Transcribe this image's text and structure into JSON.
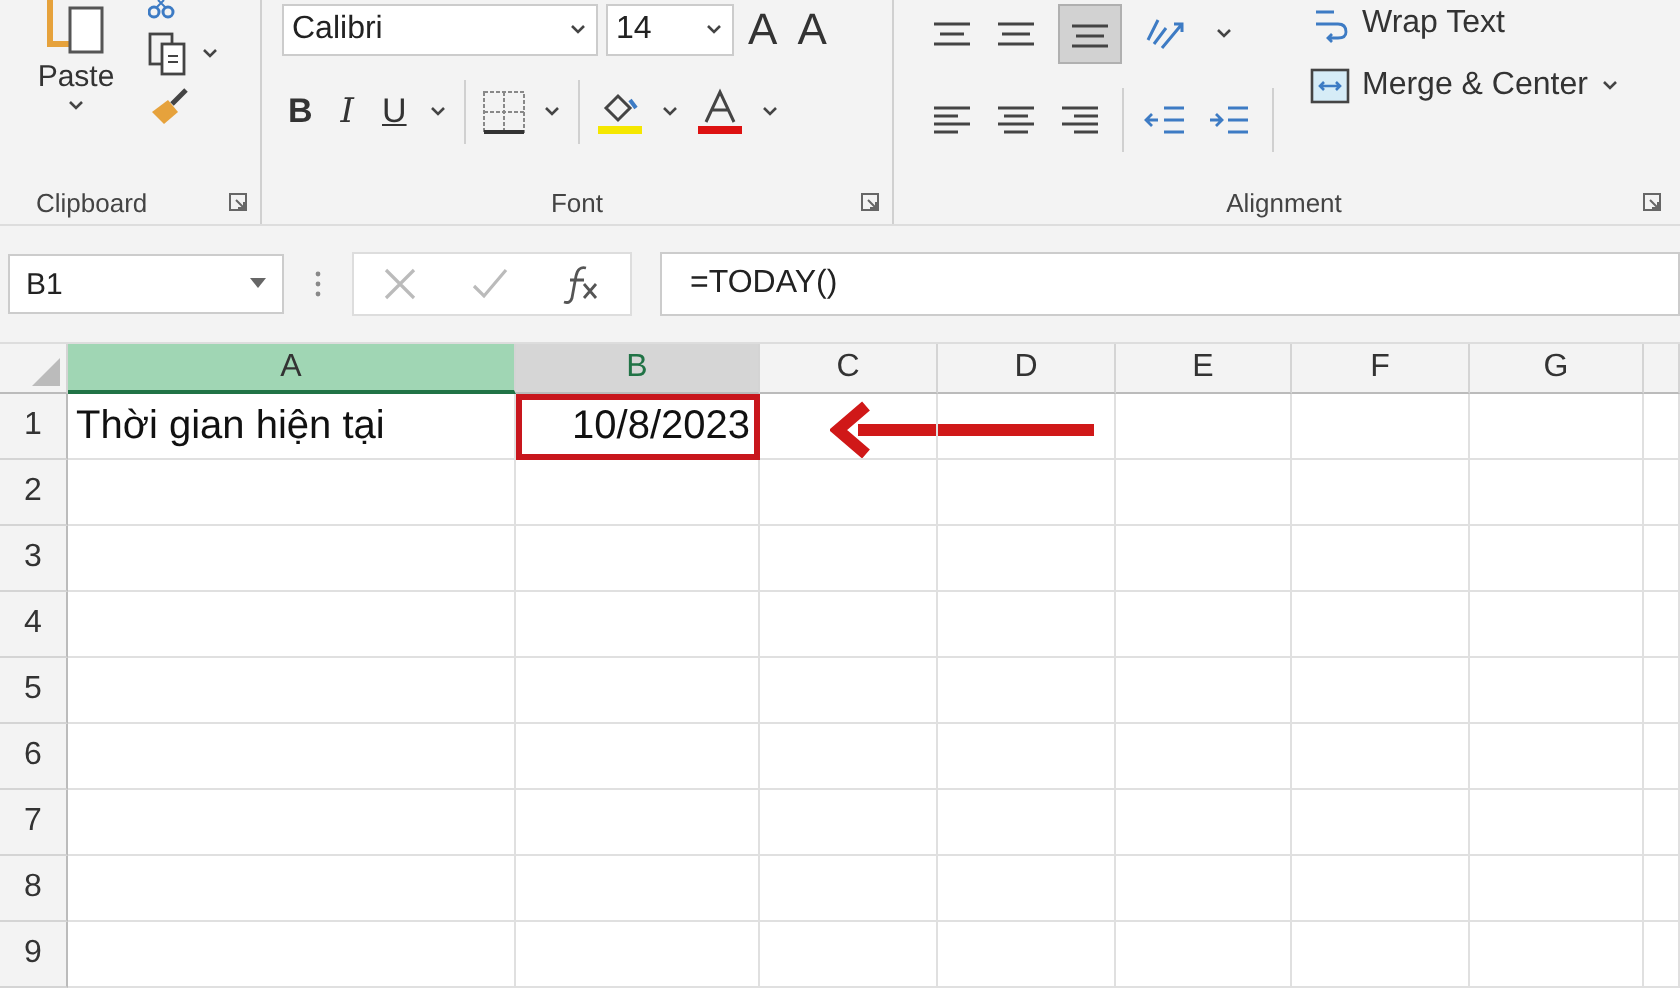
{
  "ribbon": {
    "clipboard": {
      "paste_label": "Paste",
      "group_label": "Clipboard"
    },
    "font": {
      "font_name": "Calibri",
      "font_size": "14",
      "bold": "B",
      "italic": "I",
      "underline": "U",
      "grow": "A",
      "shrink": "A",
      "group_label": "Font"
    },
    "alignment": {
      "wrap_text": "Wrap Text",
      "merge_center": "Merge & Center",
      "group_label": "Alignment",
      "middle_align_selected": true
    }
  },
  "formula_bar": {
    "name_box": "B1",
    "formula": "=TODAY()"
  },
  "grid": {
    "columns": [
      {
        "label": "A",
        "kind": "highlighted"
      },
      {
        "label": "B",
        "kind": "active"
      },
      {
        "label": "C",
        "kind": "normal"
      },
      {
        "label": "D",
        "kind": "normal"
      },
      {
        "label": "E",
        "kind": "normal"
      },
      {
        "label": "F",
        "kind": "normal"
      },
      {
        "label": "G",
        "kind": "normal"
      }
    ],
    "rows": [
      {
        "label": "1",
        "cells": [
          {
            "text": "Thời gian hiện tại",
            "boxed": false,
            "arrow": false
          },
          {
            "text": "10/8/2023",
            "boxed": true,
            "arrow": true
          }
        ]
      },
      {
        "label": "2",
        "cells": []
      },
      {
        "label": "3",
        "cells": []
      },
      {
        "label": "4",
        "cells": []
      },
      {
        "label": "5",
        "cells": []
      },
      {
        "label": "6",
        "cells": []
      },
      {
        "label": "7",
        "cells": []
      },
      {
        "label": "8",
        "cells": []
      },
      {
        "label": "9",
        "cells": []
      }
    ]
  }
}
